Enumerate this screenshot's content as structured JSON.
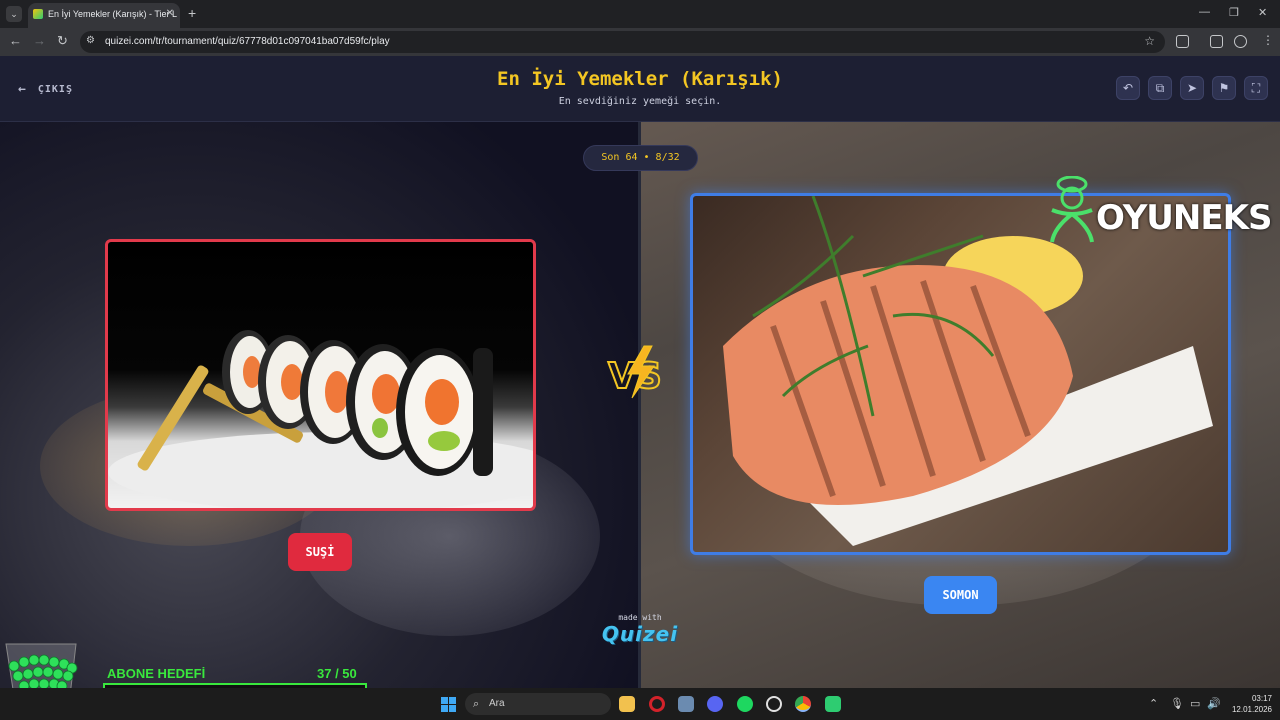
{
  "browser": {
    "tab_title": "En İyi Yemekler (Karışık) - Tier L",
    "url": "quizei.com/tr/tournament/quiz/67778d01c097041ba07d59fc/play"
  },
  "header": {
    "exit_label": "ÇIKIŞ",
    "title": "En İyi Yemekler (Karışık)",
    "subtitle": "En sevdiğiniz yemeği seçin."
  },
  "round": {
    "label": "Son 64 • 8/32"
  },
  "options": {
    "left": {
      "label": "SUŞİ",
      "accent": "#e02a3e"
    },
    "right": {
      "label": "SOMON",
      "accent": "#3a86f2"
    }
  },
  "branding": {
    "made_with": "made with",
    "logo": "Quizei",
    "watermark": "OYUNEKS"
  },
  "overlay": {
    "goal_label": "ABONE HEDEFİ",
    "goal_count": "37  / 50",
    "goal_progress": 0.74
  },
  "taskbar": {
    "search_placeholder": "Ara",
    "time": "03:17",
    "date": "12.01.2026"
  },
  "colors": {
    "title": "#f3c623",
    "header_bg": "#1d1f33",
    "goal_green": "#39e83d"
  }
}
